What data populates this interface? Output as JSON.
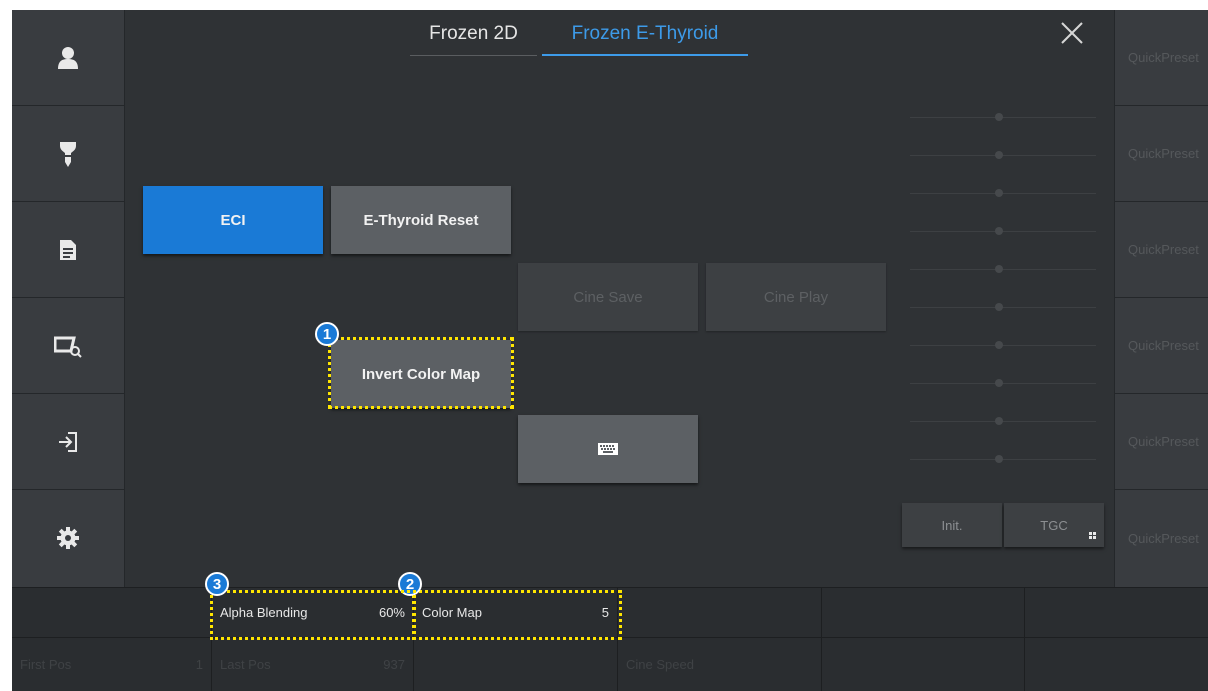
{
  "tabs": {
    "frozen_2d": "Frozen 2D",
    "frozen_thyroid": "Frozen E-Thyroid",
    "active": "frozen_thyroid"
  },
  "sidebar": {
    "items": [
      {
        "icon": "patient-icon"
      },
      {
        "icon": "probe-icon"
      },
      {
        "icon": "report-icon"
      },
      {
        "icon": "image-review-icon"
      },
      {
        "icon": "exit-icon"
      },
      {
        "icon": "settings-icon"
      }
    ]
  },
  "buttons": {
    "eci": "ECI",
    "eti_reset": "E-Thyroid Reset",
    "cine_save": "Cine Save",
    "cine_play": "Cine Play",
    "invert_color_map": "Invert Color Map",
    "keyboard_icon": "keyboard-icon"
  },
  "tgc": {
    "init_label": "Init.",
    "tgc_label": "TGC",
    "grip_icon": "grip-icon"
  },
  "quick_presets": [
    "QuickPreset",
    "QuickPreset",
    "QuickPreset",
    "QuickPreset",
    "QuickPreset",
    "QuickPreset"
  ],
  "params": {
    "alpha_blending": {
      "label": "Alpha Blending",
      "value": "60%"
    },
    "color_map": {
      "label": "Color Map",
      "value": "5"
    },
    "first_pos": {
      "label": "First Pos",
      "value": "1"
    },
    "last_pos": {
      "label": "Last Pos",
      "value": "937"
    },
    "cine_speed": {
      "label": "Cine Speed",
      "value": ""
    }
  },
  "callouts": [
    "1",
    "2",
    "3"
  ],
  "colors": {
    "accent": "#1a7ad6",
    "tab_active": "#3d9be9",
    "callout_border": "#ffe600",
    "background": "#2f3235"
  }
}
